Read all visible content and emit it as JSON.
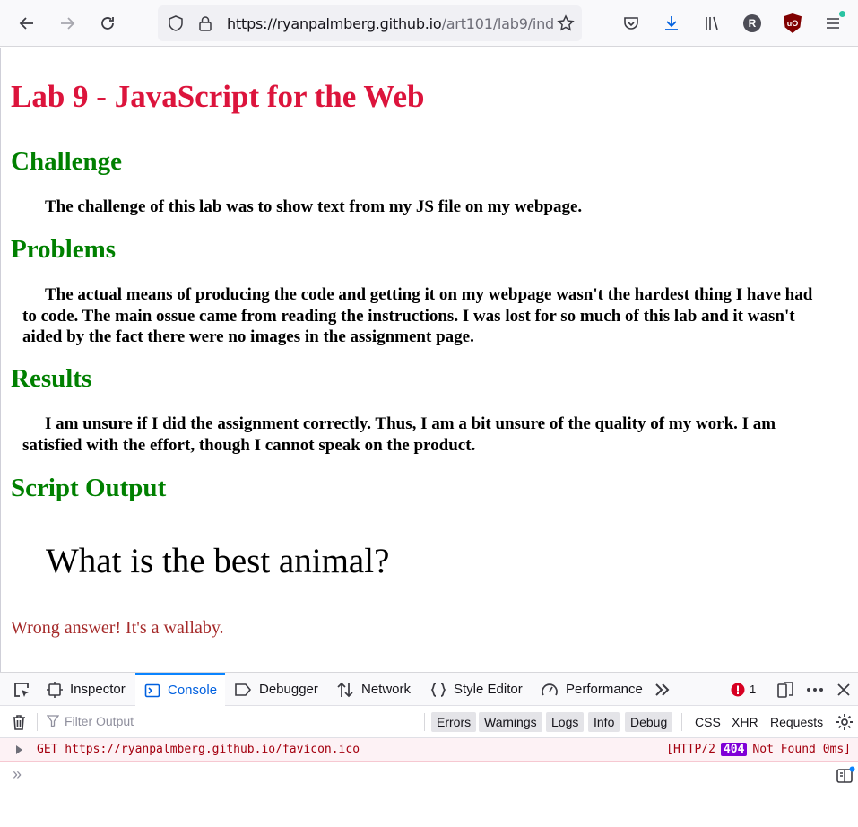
{
  "browser": {
    "url_main": "https://ryanpalmberg.github.io",
    "url_path": "/art101/lab9/ind",
    "profile_initial": "R",
    "ublock_label": "uO"
  },
  "page": {
    "title": "Lab 9 - JavaScript for the Web",
    "sections": [
      {
        "heading": "Challenge",
        "text": "The challenge of this lab was to show text from my JS file on my webpage."
      },
      {
        "heading": "Problems",
        "text": "The actual means of producing the code and getting it on my webpage wasn't the hardest thing I have had to code. The main ossue came from reading the instructions. I was lost for so much of this lab and it wasn't aided by the fact there were no images in the assignment page."
      },
      {
        "heading": "Results",
        "text": "I am unsure if I did the assignment correctly. Thus, I am a bit unsure of the quality of my work. I am satisfied with the effort, though I cannot speak on the product."
      },
      {
        "heading": "Script Output"
      }
    ],
    "question": "What is the best animal?",
    "answer": "Wrong answer! It's a wallaby."
  },
  "devtools": {
    "tabs": [
      "Inspector",
      "Console",
      "Debugger",
      "Network",
      "Style Editor",
      "Performance"
    ],
    "active_tab": "Console",
    "error_count": "1",
    "filter_placeholder": "Filter Output",
    "levels": [
      "Errors",
      "Warnings",
      "Logs",
      "Info",
      "Debug"
    ],
    "types": [
      "CSS",
      "XHR",
      "Requests"
    ],
    "log": {
      "method_url": "GET https://ryanpalmberg.github.io/favicon.ico",
      "proto": "[HTTP/2",
      "code": "404",
      "status_rest": "Not Found 0ms]"
    },
    "prompt_symbol": "»"
  },
  "colors": {
    "title": "#dc143c",
    "heading": "#008000",
    "answer": "#a52a2a",
    "accent": "#0060df",
    "badge": "#8000d7"
  }
}
